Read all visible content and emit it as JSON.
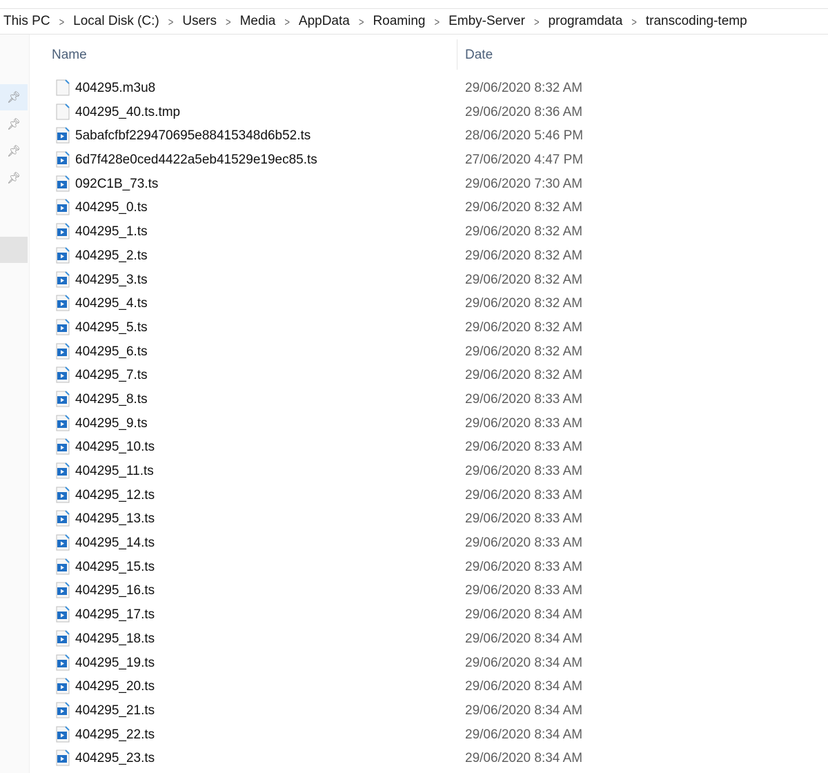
{
  "breadcrumb": [
    "This PC",
    "Local Disk (C:)",
    "Users",
    "Media",
    "AppData",
    "Roaming",
    "Emby-Server",
    "programdata",
    "transcoding-temp"
  ],
  "columns": {
    "name": "Name",
    "date": "Date"
  },
  "files": [
    {
      "name": "404295.m3u8",
      "date": "29/06/2020 8:32 AM",
      "type": "generic"
    },
    {
      "name": "404295_40.ts.tmp",
      "date": "29/06/2020 8:36 AM",
      "type": "generic"
    },
    {
      "name": "5abafcfbf229470695e88415348d6b52.ts",
      "date": "28/06/2020 5:46 PM",
      "type": "video"
    },
    {
      "name": "6d7f428e0ced4422a5eb41529e19ec85.ts",
      "date": "27/06/2020 4:47 PM",
      "type": "video"
    },
    {
      "name": "092C1B_73.ts",
      "date": "29/06/2020 7:30 AM",
      "type": "video"
    },
    {
      "name": "404295_0.ts",
      "date": "29/06/2020 8:32 AM",
      "type": "video"
    },
    {
      "name": "404295_1.ts",
      "date": "29/06/2020 8:32 AM",
      "type": "video"
    },
    {
      "name": "404295_2.ts",
      "date": "29/06/2020 8:32 AM",
      "type": "video"
    },
    {
      "name": "404295_3.ts",
      "date": "29/06/2020 8:32 AM",
      "type": "video"
    },
    {
      "name": "404295_4.ts",
      "date": "29/06/2020 8:32 AM",
      "type": "video"
    },
    {
      "name": "404295_5.ts",
      "date": "29/06/2020 8:32 AM",
      "type": "video"
    },
    {
      "name": "404295_6.ts",
      "date": "29/06/2020 8:32 AM",
      "type": "video"
    },
    {
      "name": "404295_7.ts",
      "date": "29/06/2020 8:32 AM",
      "type": "video"
    },
    {
      "name": "404295_8.ts",
      "date": "29/06/2020 8:33 AM",
      "type": "video"
    },
    {
      "name": "404295_9.ts",
      "date": "29/06/2020 8:33 AM",
      "type": "video"
    },
    {
      "name": "404295_10.ts",
      "date": "29/06/2020 8:33 AM",
      "type": "video"
    },
    {
      "name": "404295_11.ts",
      "date": "29/06/2020 8:33 AM",
      "type": "video"
    },
    {
      "name": "404295_12.ts",
      "date": "29/06/2020 8:33 AM",
      "type": "video"
    },
    {
      "name": "404295_13.ts",
      "date": "29/06/2020 8:33 AM",
      "type": "video"
    },
    {
      "name": "404295_14.ts",
      "date": "29/06/2020 8:33 AM",
      "type": "video"
    },
    {
      "name": "404295_15.ts",
      "date": "29/06/2020 8:33 AM",
      "type": "video"
    },
    {
      "name": "404295_16.ts",
      "date": "29/06/2020 8:33 AM",
      "type": "video"
    },
    {
      "name": "404295_17.ts",
      "date": "29/06/2020 8:34 AM",
      "type": "video"
    },
    {
      "name": "404295_18.ts",
      "date": "29/06/2020 8:34 AM",
      "type": "video"
    },
    {
      "name": "404295_19.ts",
      "date": "29/06/2020 8:34 AM",
      "type": "video"
    },
    {
      "name": "404295_20.ts",
      "date": "29/06/2020 8:34 AM",
      "type": "video"
    },
    {
      "name": "404295_21.ts",
      "date": "29/06/2020 8:34 AM",
      "type": "video"
    },
    {
      "name": "404295_22.ts",
      "date": "29/06/2020 8:34 AM",
      "type": "video"
    },
    {
      "name": "404295_23.ts",
      "date": "29/06/2020 8:34 AM",
      "type": "video"
    }
  ]
}
